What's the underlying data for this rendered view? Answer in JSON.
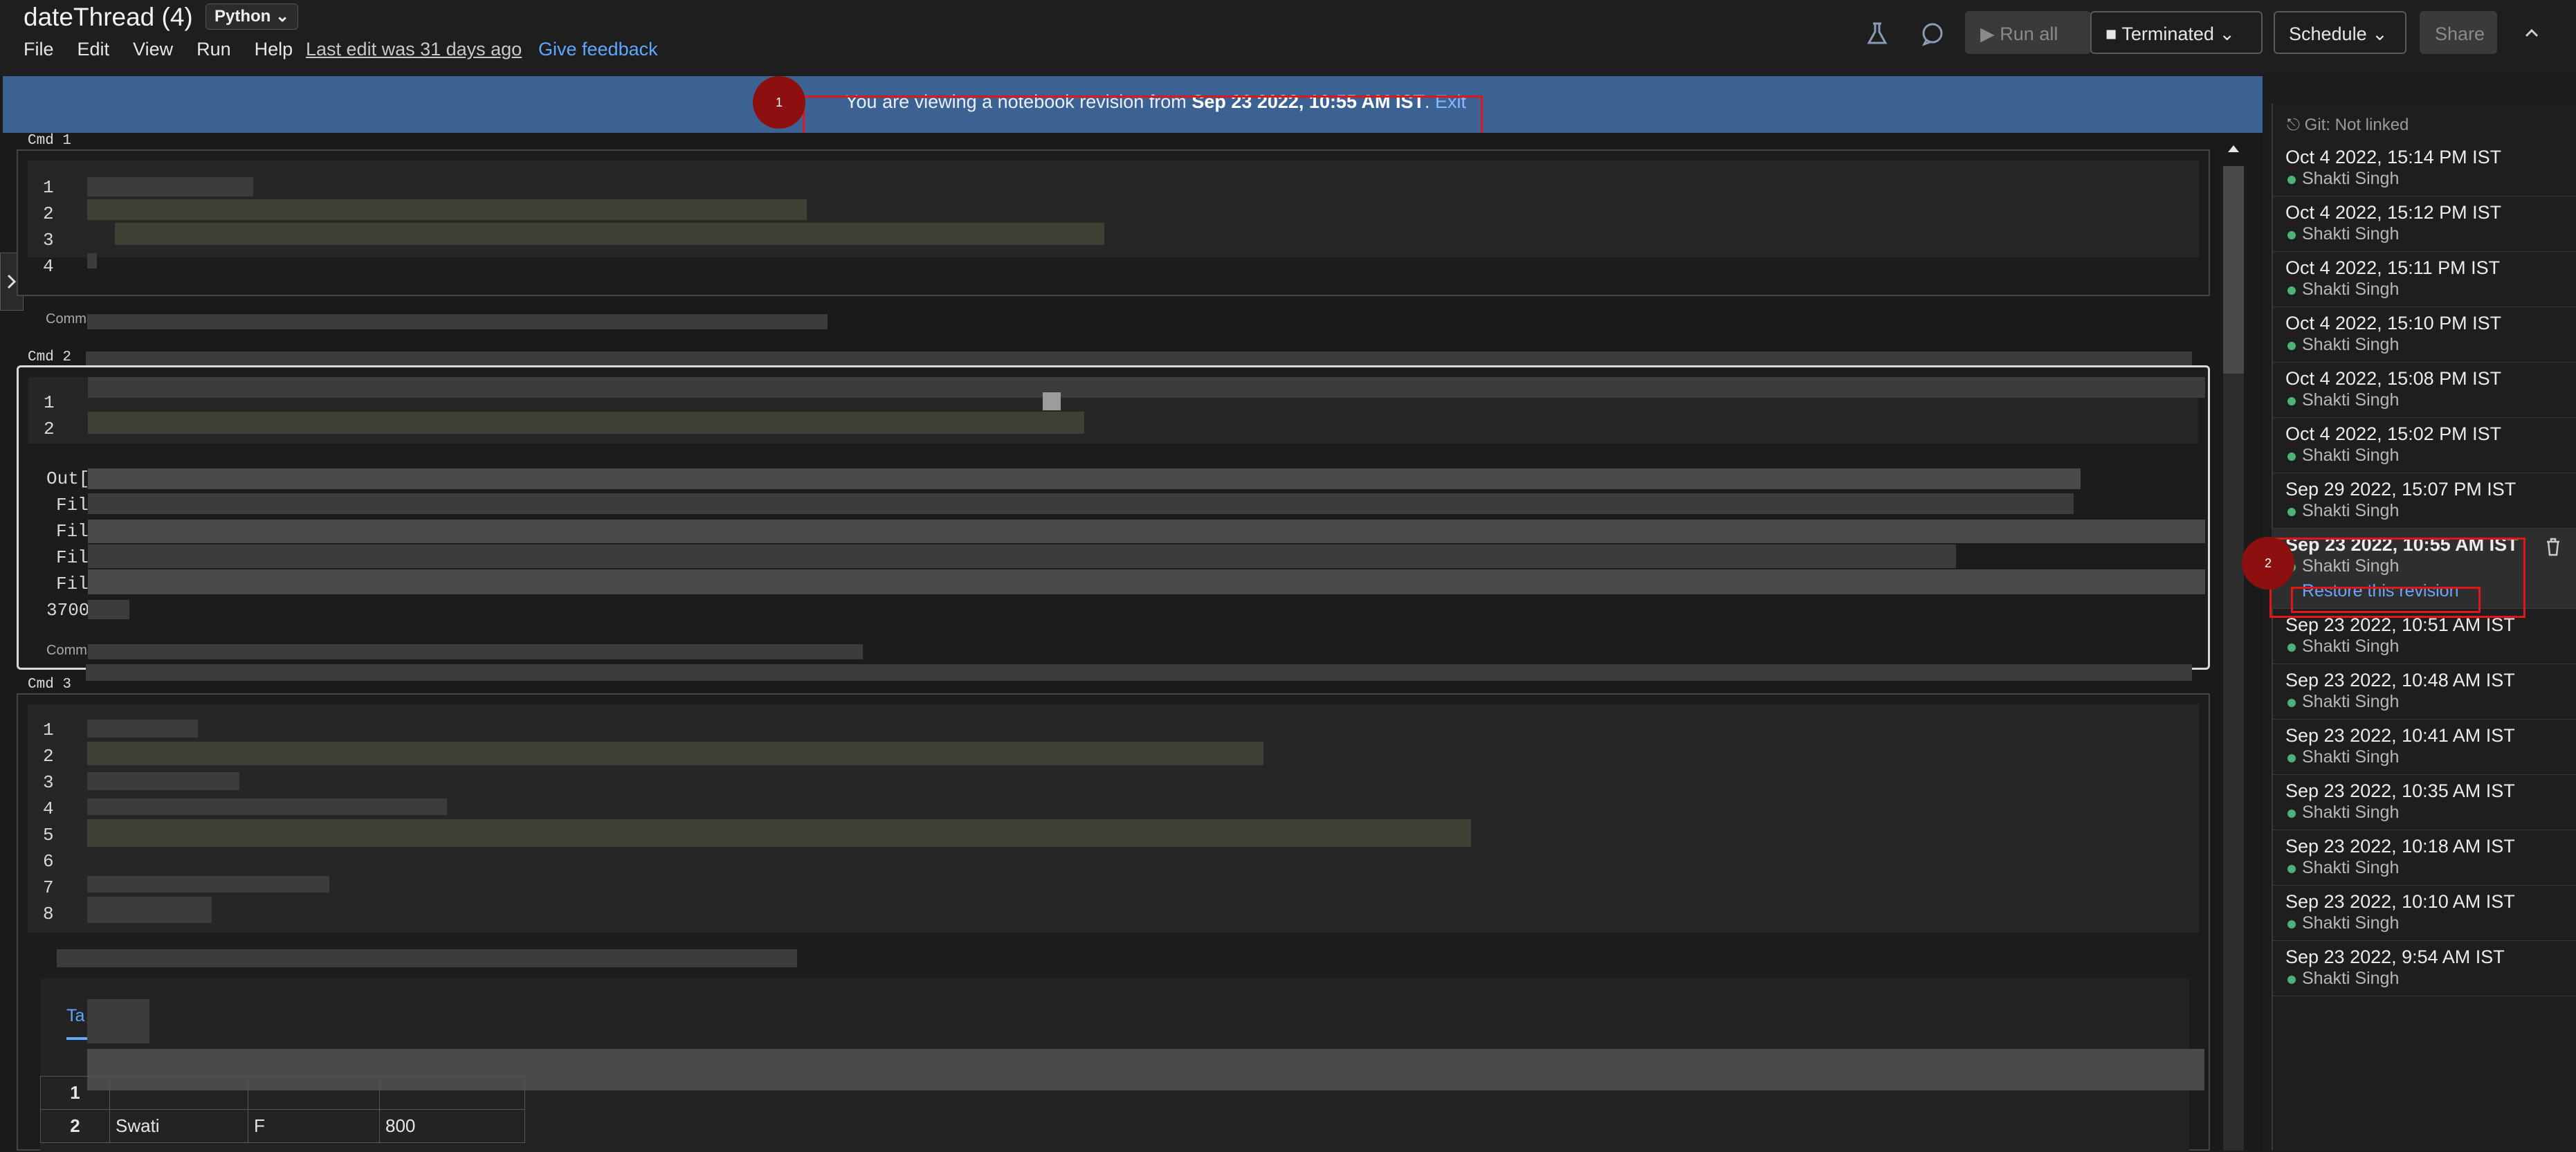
{
  "header": {
    "title": "dateThread (4)",
    "language": "Python",
    "menu": [
      "File",
      "Edit",
      "View",
      "Run",
      "Help"
    ],
    "last_edit": "Last edit was 31 days ago",
    "feedback": "Give feedback",
    "run_all": "Run all",
    "cluster": "Terminated",
    "schedule": "Schedule",
    "share": "Share"
  },
  "banner": {
    "prefix": "You are viewing a notebook revision from",
    "revision": "Sep 23 2022, 10:55 AM IST",
    "exit": "Exit",
    "marker": "1"
  },
  "cells": [
    {
      "label": "Cmd 1",
      "lines": [
        "1",
        "2",
        "3",
        "4"
      ],
      "footer": "Comma"
    },
    {
      "label": "Cmd 2",
      "lines": [
        "1",
        "2"
      ],
      "output": [
        "Out[",
        "Fil",
        "Fil",
        "Fil",
        "Fil",
        "3700"
      ],
      "footer": "Comma"
    },
    {
      "label": "Cmd 3",
      "lines": [
        "1",
        "2",
        "3",
        "4",
        "5",
        "6",
        "7",
        "8"
      ],
      "tab": "Ta"
    }
  ],
  "table": {
    "row_numbers": [
      "1",
      "2"
    ],
    "visible_row": [
      "Swati",
      "F",
      "800"
    ]
  },
  "revisions_panel": {
    "git": "Git: Not linked",
    "marker": "2",
    "restore": "Restore this revision",
    "items": [
      {
        "date": "Oct 4 2022, 15:14 PM IST",
        "user": "Shakti Singh"
      },
      {
        "date": "Oct 4 2022, 15:12 PM IST",
        "user": "Shakti Singh"
      },
      {
        "date": "Oct 4 2022, 15:11 PM IST",
        "user": "Shakti Singh"
      },
      {
        "date": "Oct 4 2022, 15:10 PM IST",
        "user": "Shakti Singh"
      },
      {
        "date": "Oct 4 2022, 15:08 PM IST",
        "user": "Shakti Singh"
      },
      {
        "date": "Oct 4 2022, 15:02 PM IST",
        "user": "Shakti Singh"
      },
      {
        "date": "Sep 29 2022, 15:07 PM IST",
        "user": "Shakti Singh"
      },
      {
        "date": "Sep 23 2022, 10:55 AM IST",
        "user": "Shakti Singh"
      },
      {
        "date": "Sep 23 2022, 10:51 AM IST",
        "user": "Shakti Singh"
      },
      {
        "date": "Sep 23 2022, 10:48 AM IST",
        "user": "Shakti Singh"
      },
      {
        "date": "Sep 23 2022, 10:41 AM IST",
        "user": "Shakti Singh"
      },
      {
        "date": "Sep 23 2022, 10:35 AM IST",
        "user": "Shakti Singh"
      },
      {
        "date": "Sep 23 2022, 10:18 AM IST",
        "user": "Shakti Singh"
      },
      {
        "date": "Sep 23 2022, 10:10 AM IST",
        "user": "Shakti Singh"
      },
      {
        "date": "Sep 23 2022, 9:54 AM IST",
        "user": "Shakti Singh"
      }
    ]
  }
}
